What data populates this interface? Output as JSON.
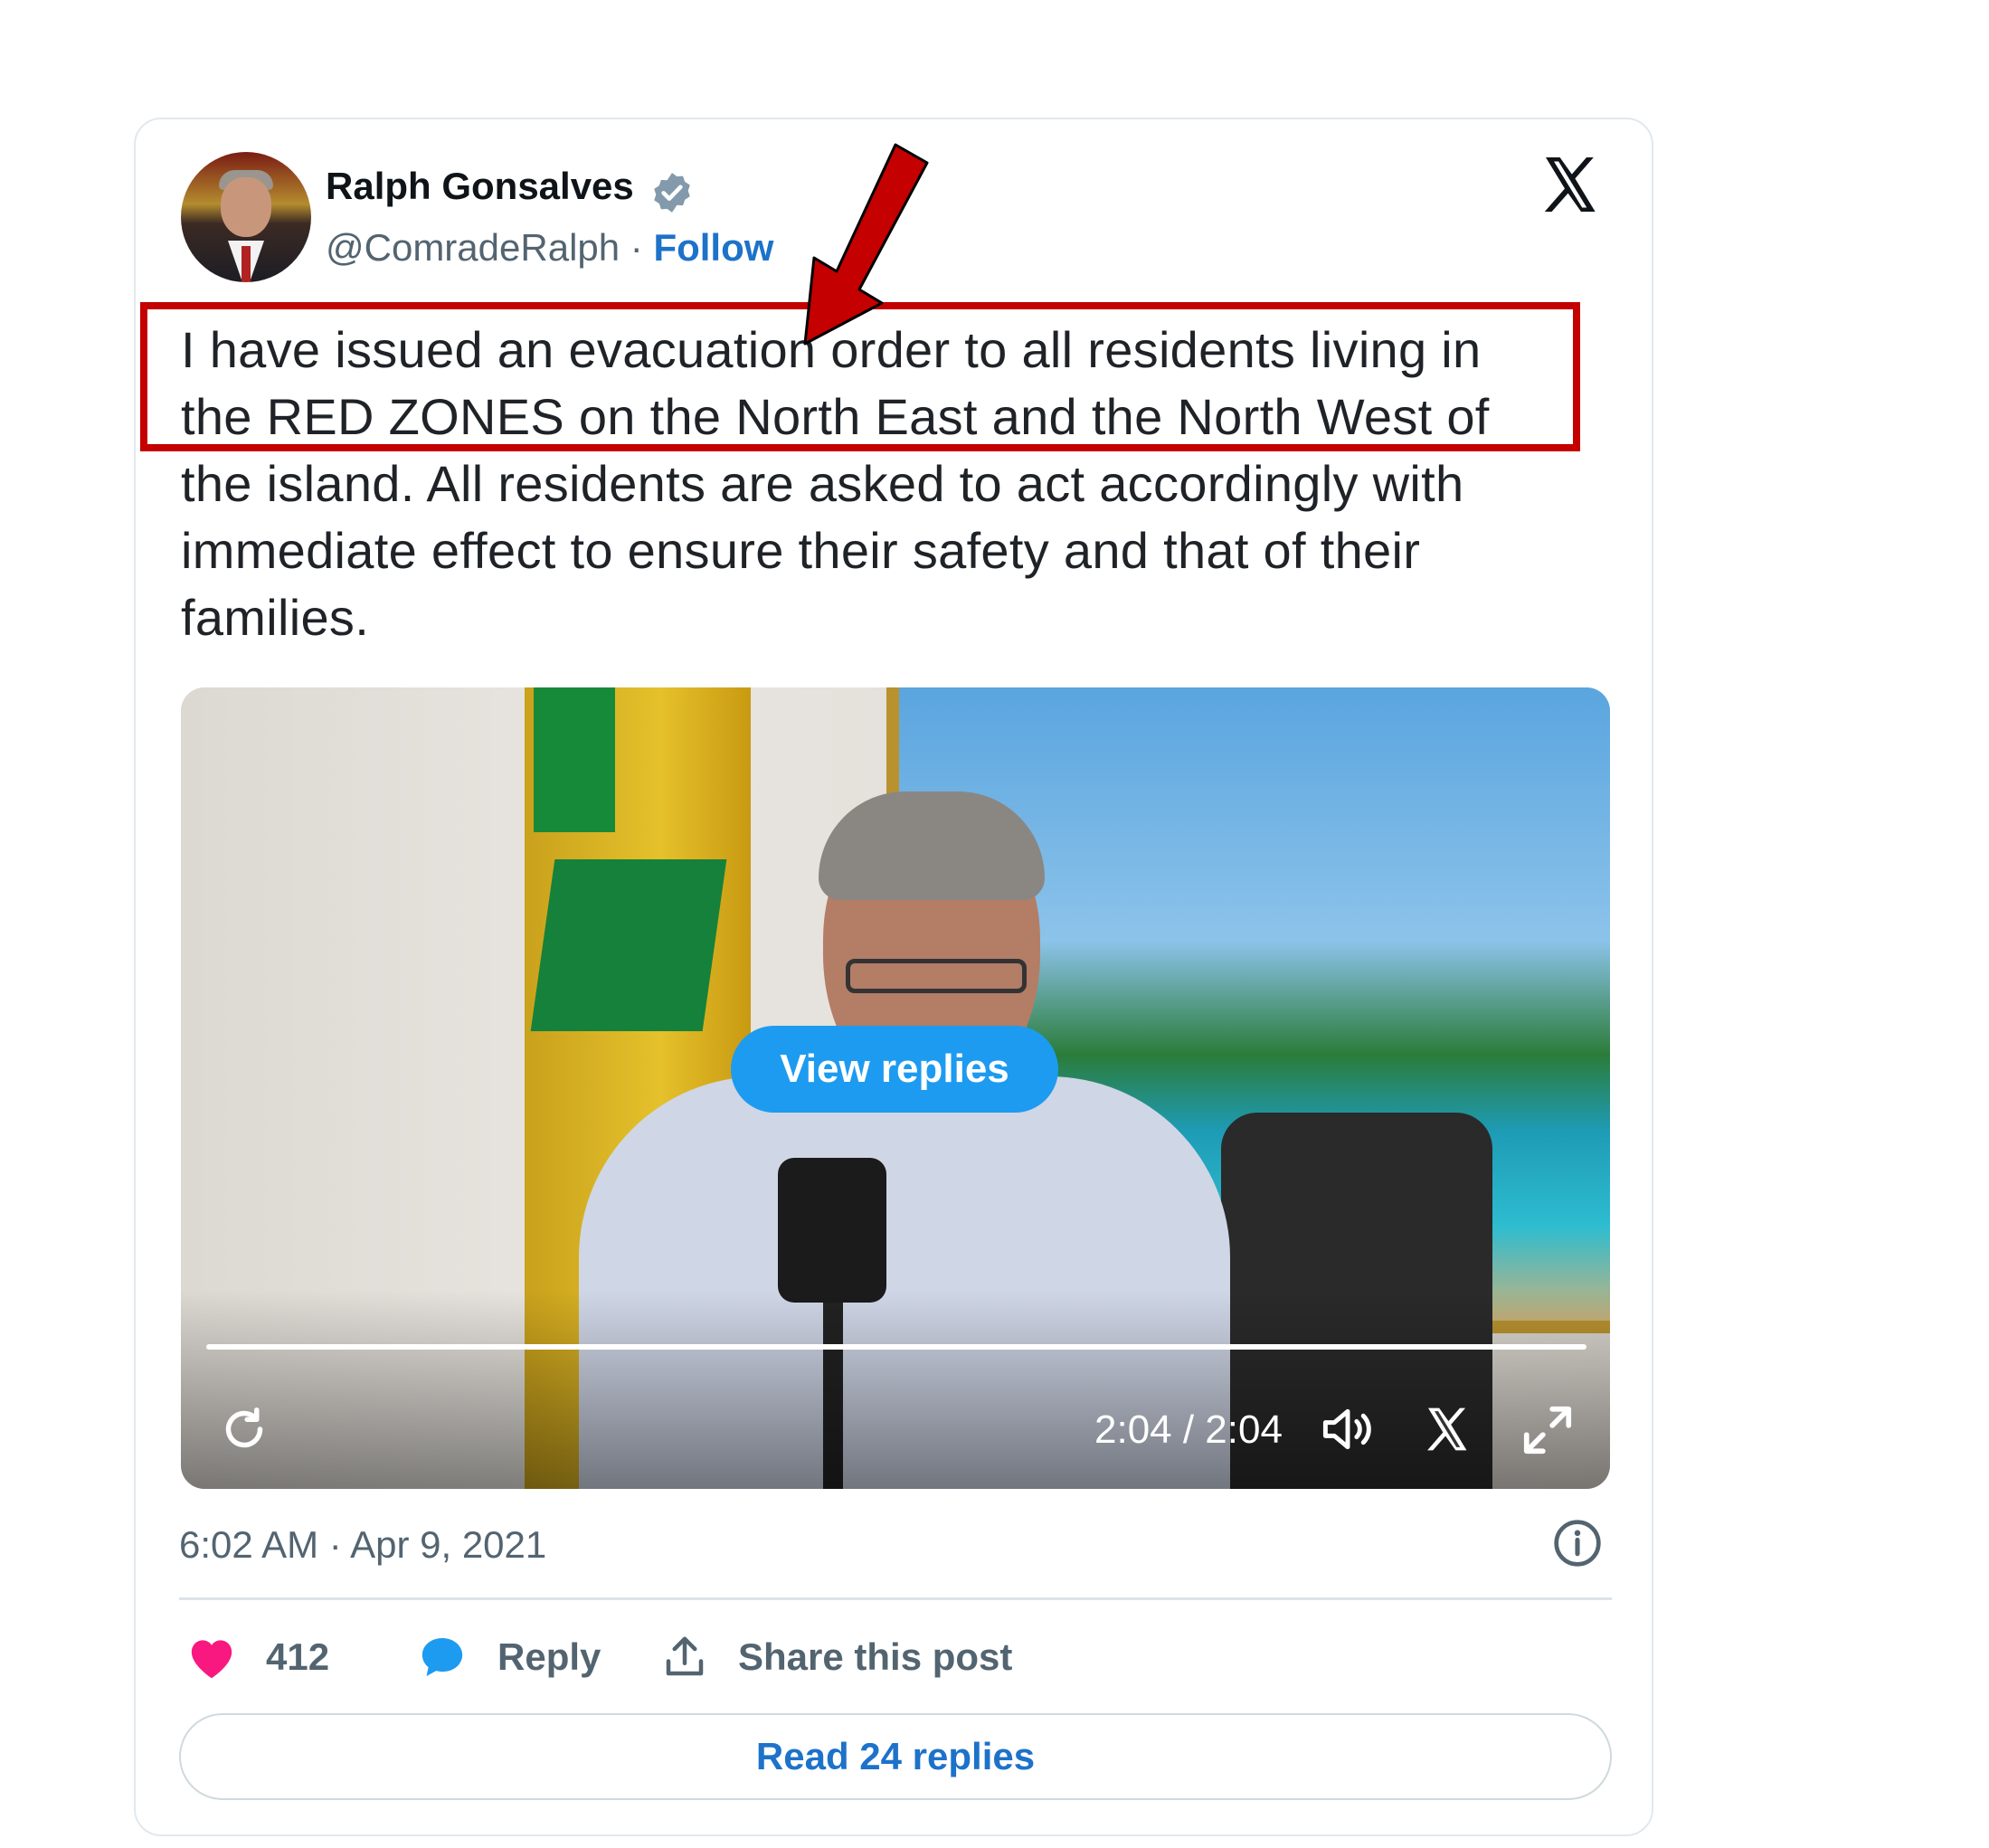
{
  "author": {
    "name": "Ralph Gonsalves",
    "handle": "@ComradeRalph",
    "separator": " · ",
    "follow_label": "Follow"
  },
  "tweet": {
    "lines": [
      "I have issued an evacuation order to all residents living in",
      "the RED ZONES on the North East and the North West of",
      "the island. All residents are asked to act accordingly with",
      "immediate effect to ensure their safety and that of their",
      "families."
    ]
  },
  "video": {
    "view_replies_label": "View replies",
    "time_display": "2:04 / 2:04",
    "progress_fraction": 1.0
  },
  "meta": {
    "timestamp": "6:02 AM · Apr 9, 2021"
  },
  "actions": {
    "like_count": "412",
    "reply_label": "Reply",
    "share_label": "Share this post",
    "read_replies_label": "Read 24 replies"
  },
  "colors": {
    "accent": "#1d9bf0",
    "link": "#1d72c9",
    "like": "#f91880",
    "annotation": "#c40000"
  },
  "icons": [
    "verified-badge-icon",
    "x-logo-icon",
    "replay-icon",
    "volume-icon",
    "x-small-icon",
    "expand-icon",
    "info-icon",
    "heart-icon",
    "reply-bubble-icon",
    "share-icon",
    "annotation-arrow-icon"
  ]
}
